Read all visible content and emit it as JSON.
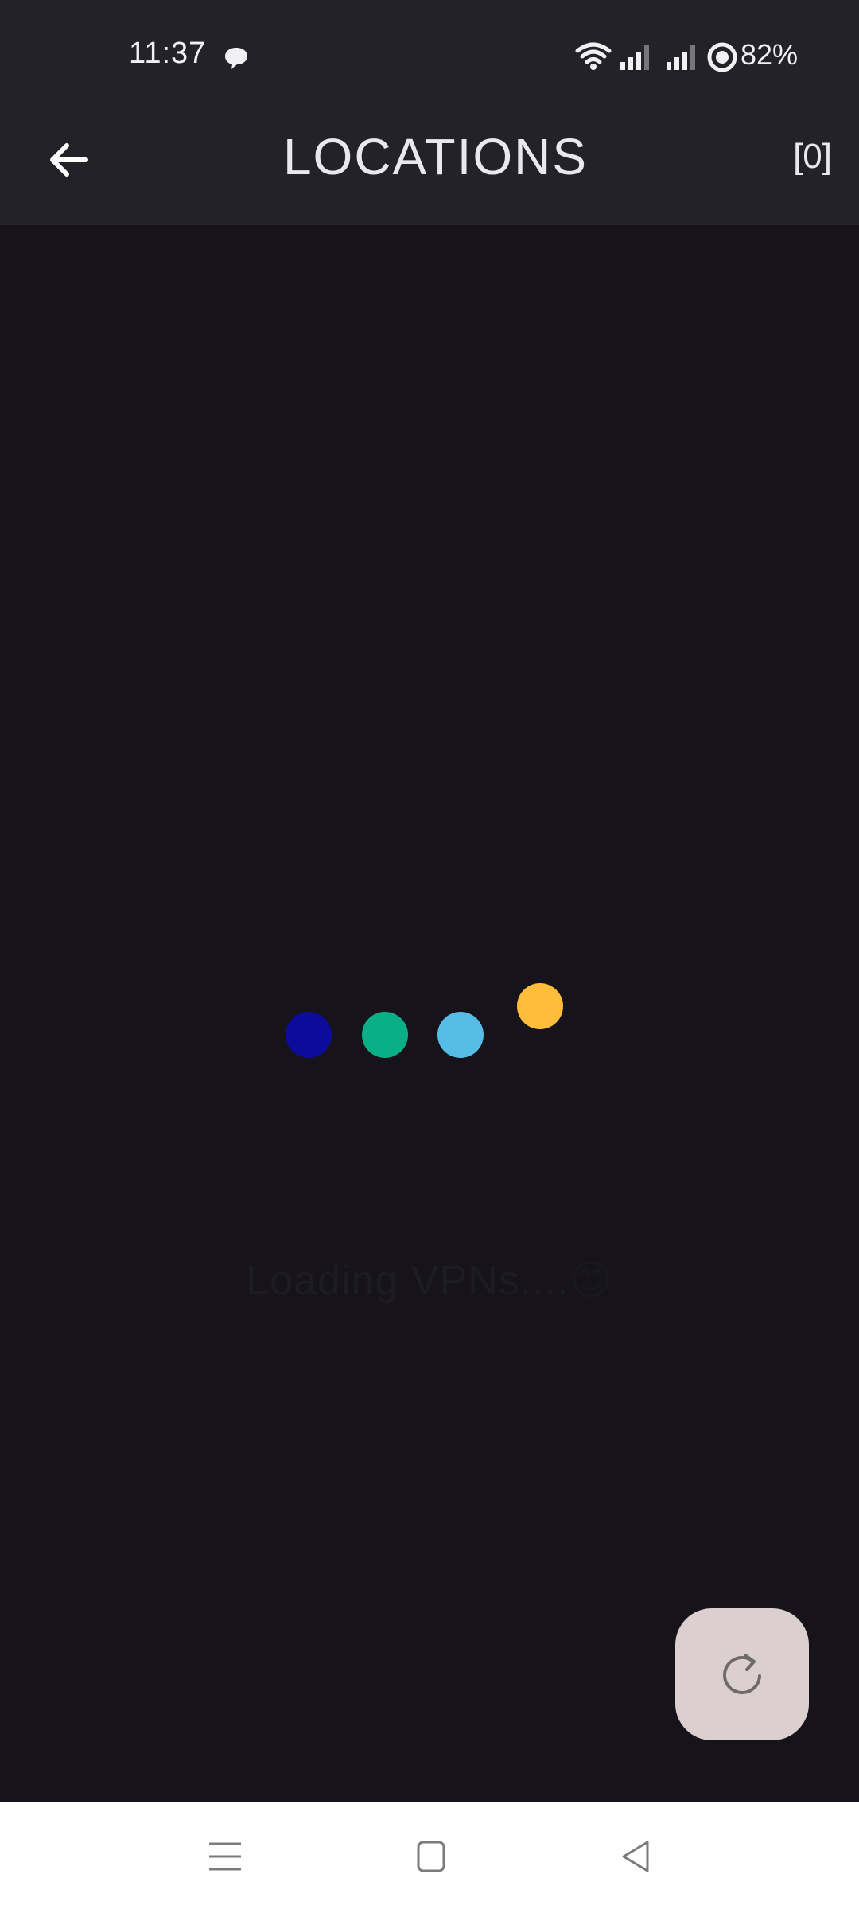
{
  "status_bar": {
    "time": "11:37",
    "battery": "82%",
    "icons": [
      "chat-bubble-icon",
      "wifi-icon",
      "signal-icon",
      "signal-icon",
      "battery-saver-icon"
    ]
  },
  "app_bar": {
    "title": "LOCATIONS",
    "count": "[0]",
    "back_icon": "arrow-back-icon"
  },
  "loader": {
    "dot_colors": [
      "#0d0b99",
      "#0aaf88",
      "#55bde6",
      "#ffbd3a"
    ],
    "message": "Loading VPNs....",
    "emoji": "😊"
  },
  "fab": {
    "icon": "refresh-icon",
    "background": "#dccfcf"
  },
  "nav_bar": {
    "icons": [
      "menu-icon",
      "home-square-icon",
      "back-triangle-icon"
    ]
  }
}
